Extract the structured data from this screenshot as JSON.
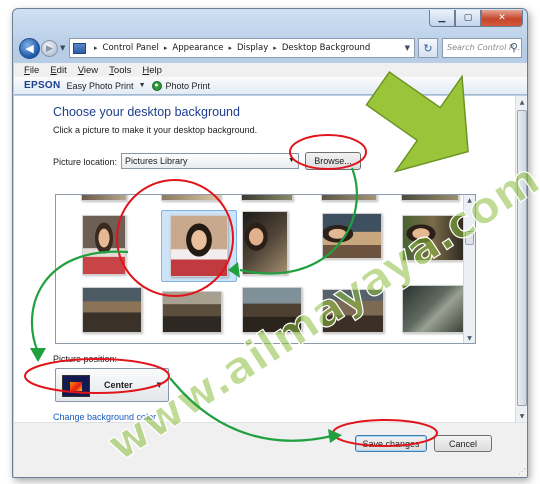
{
  "window": {
    "minimize_glyph": "▁",
    "maximize_glyph": "▢",
    "close_glyph": "✕"
  },
  "nav": {
    "back_glyph": "◀",
    "forward_glyph": "▶",
    "breadcrumb": [
      "Control Panel",
      "Appearance",
      "Display",
      "Desktop Background"
    ],
    "breadcrumb_separator": "▸",
    "refresh_glyph": "↻",
    "search_placeholder": "Search Control P...",
    "search_glyph": "⚲"
  },
  "menu": [
    "File",
    "Edit",
    "View",
    "Tools",
    "Help"
  ],
  "toolbar": {
    "brand": "EPSON",
    "easy_photo_print": "Easy Photo Print",
    "photo_print": "Photo Print",
    "dropdown_glyph": "▼"
  },
  "page": {
    "title": "Choose your desktop background",
    "description": "Click a picture to make it your desktop background.",
    "location_label": "Picture location:",
    "location_value": "Pictures Library",
    "browse_label": "Browse...",
    "position_label": "Picture position:",
    "position_value": "Center",
    "bg_color_link": "Change background color"
  },
  "footer": {
    "save_label": "Save changes",
    "cancel_label": "Cancel"
  },
  "annotations": {
    "accent_red": "#e0141b",
    "accent_green": "#21a040",
    "arrow_green": "#9ac43a"
  },
  "watermark": "www.ailmayaya.com"
}
